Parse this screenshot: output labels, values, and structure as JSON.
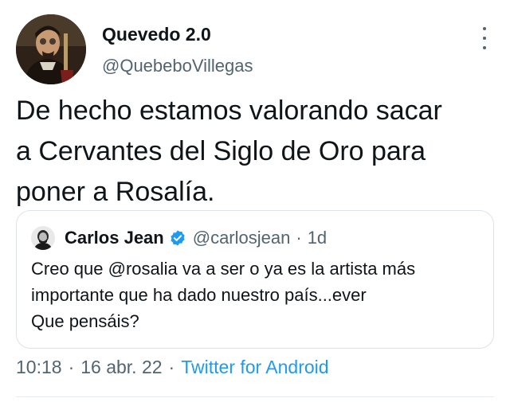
{
  "author": {
    "name": "Quevedo 2.0",
    "handle": "@QuebeboVillegas"
  },
  "tweet": {
    "lines": [
      "De hecho estamos valorando sacar",
      "a Cervantes del Siglo de Oro para",
      "poner a Rosalía."
    ]
  },
  "quoted": {
    "name": "Carlos Jean",
    "handle": "@carlosjean",
    "separator": "·",
    "time": "1d",
    "lines": [
      "Creo que @rosalia va a ser o ya es la artista más",
      "importante que ha dado nuestro país...ever",
      "Que pensáis?"
    ]
  },
  "meta": {
    "time": "10:18",
    "separator": "·",
    "date": "16 abr. 22",
    "source": "Twitter for Android"
  },
  "icons": {
    "more": "more-vertical-icon",
    "verified": "verified-badge-icon"
  },
  "colors": {
    "text": "#0f1419",
    "secondary": "#536471",
    "accent": "#1d9bf0",
    "border": "#dde3e8"
  }
}
